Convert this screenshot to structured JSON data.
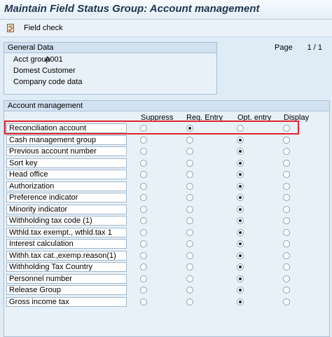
{
  "title": "Maintain Field Status Group: Account management",
  "toolbar": {
    "field_check": "Field check",
    "icon": "document-check-icon"
  },
  "pager": {
    "label": "Page",
    "value": "1 / 1"
  },
  "general_data": {
    "heading": "General Data",
    "acct_group_label": "Acct group",
    "acct_group_value": "A001",
    "description": "Domest  Customer",
    "section": "Company code data"
  },
  "account_management": {
    "heading": "Account management",
    "columns": [
      "Suppress",
      "Req. Entry",
      "Opt. entry",
      "Display"
    ],
    "rows": [
      {
        "label": "Reconciliation account",
        "selected": 1
      },
      {
        "label": "Cash management group",
        "selected": 2
      },
      {
        "label": "Previous account number",
        "selected": 2
      },
      {
        "label": "Sort key",
        "selected": 2
      },
      {
        "label": "Head office",
        "selected": 2
      },
      {
        "label": "Authorization",
        "selected": 2
      },
      {
        "label": "Preference indicator",
        "selected": 2
      },
      {
        "label": "Minority indicator",
        "selected": 2
      },
      {
        "label": "Withholding tax code (1)",
        "selected": 2
      },
      {
        "label": "Wthld.tax exempt., wthld.tax 1",
        "selected": 2
      },
      {
        "label": "Interest calculation",
        "selected": 2
      },
      {
        "label": "Withh.tax cat.,exemp.reason(1)",
        "selected": 2
      },
      {
        "label": "Withholding Tax Country",
        "selected": 2
      },
      {
        "label": "Personnel number",
        "selected": 2
      },
      {
        "label": "Release Group",
        "selected": 2
      },
      {
        "label": "Gross income tax",
        "selected": 2
      }
    ]
  },
  "colors": {
    "highlight": "#e0242b",
    "background": "#dfebf5"
  }
}
